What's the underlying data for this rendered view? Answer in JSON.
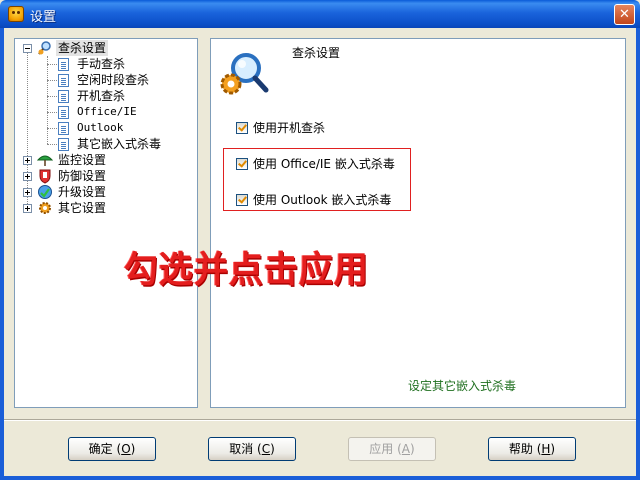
{
  "window": {
    "title": "设置"
  },
  "tree": {
    "root": {
      "label": "查杀设置"
    },
    "children": [
      "手动查杀",
      "空闲时段查杀",
      "开机查杀",
      "Office/IE",
      "Outlook",
      "其它嵌入式杀毒"
    ],
    "categories": [
      "监控设置",
      "防御设置",
      "升级设置",
      "其它设置"
    ]
  },
  "content": {
    "title": "查杀设置",
    "options": [
      {
        "label": "使用开机查杀",
        "checked": true
      },
      {
        "label": "使用 Office/IE 嵌入式杀毒",
        "checked": true
      },
      {
        "label": "使用 Outlook 嵌入式杀毒",
        "checked": true
      }
    ],
    "overlay": "勾选并点击应用",
    "description": "设定其它嵌入式杀毒"
  },
  "buttons": {
    "ok": {
      "label": "确定",
      "key": "O"
    },
    "cancel": {
      "label": "取消",
      "key": "C"
    },
    "apply": {
      "label": "应用",
      "key": "A"
    },
    "help": {
      "label": "帮助",
      "key": "H"
    }
  },
  "colors": {
    "titlebar": "#0c4fc8",
    "highlight_box": "#e02020",
    "overlay_text": "#e41e1e",
    "description": "#207020"
  }
}
